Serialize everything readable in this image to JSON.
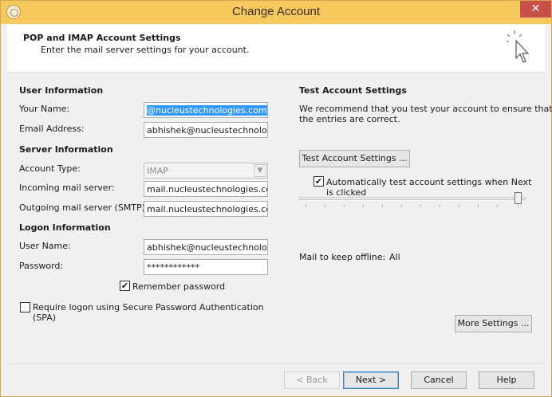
{
  "window": {
    "title": "Change Account",
    "close_glyph": "✕"
  },
  "header": {
    "title": "POP and IMAP Account Settings",
    "subtitle": "Enter the mail server settings for your account.",
    "icon": "wizard-cursor-icon"
  },
  "user_info": {
    "section_label": "User Information",
    "name_label": "Your Name:",
    "name_value": "@nucleustechnologies.com",
    "email_label": "Email Address:",
    "email_value": "abhishek@nucleustechnolo"
  },
  "server_info": {
    "section_label": "Server Information",
    "account_type_label": "Account Type:",
    "account_type_value": "IMAP",
    "incoming_label": "Incoming mail server:",
    "incoming_value": "mail.nucleustechnologies.cc",
    "outgoing_label": "Outgoing mail server (SMTP):",
    "outgoing_value": "mail.nucleustechnologies.cc"
  },
  "logon_info": {
    "section_label": "Logon Information",
    "username_label": "User Name:",
    "username_value": "abhishek@nucleustechnolo",
    "password_label": "Password:",
    "password_value": "************",
    "remember_label": "Remember password",
    "remember_checked": true,
    "spa_label_line1": "Require logon using Secure Password Authentication",
    "spa_label_line2": "(SPA)",
    "spa_checked": false
  },
  "test_settings": {
    "section_label": "Test Account Settings",
    "desc_line1": "We recommend that you test your account to ensure that",
    "desc_line2": "the entries are correct.",
    "test_button": "Test Account Settings ...",
    "auto_test_line1": "Automatically test account settings when Next",
    "auto_test_line2": "is clicked",
    "auto_test_checked": true
  },
  "offline": {
    "label": "Mail to keep offline:",
    "value": "All",
    "slider_fraction": 1.0,
    "more_settings_button": "More Settings ..."
  },
  "footer": {
    "back_button": "< Back",
    "next_button": "Next >",
    "cancel_button": "Cancel",
    "help_button": "Help"
  },
  "checkmark_glyph": "✔"
}
